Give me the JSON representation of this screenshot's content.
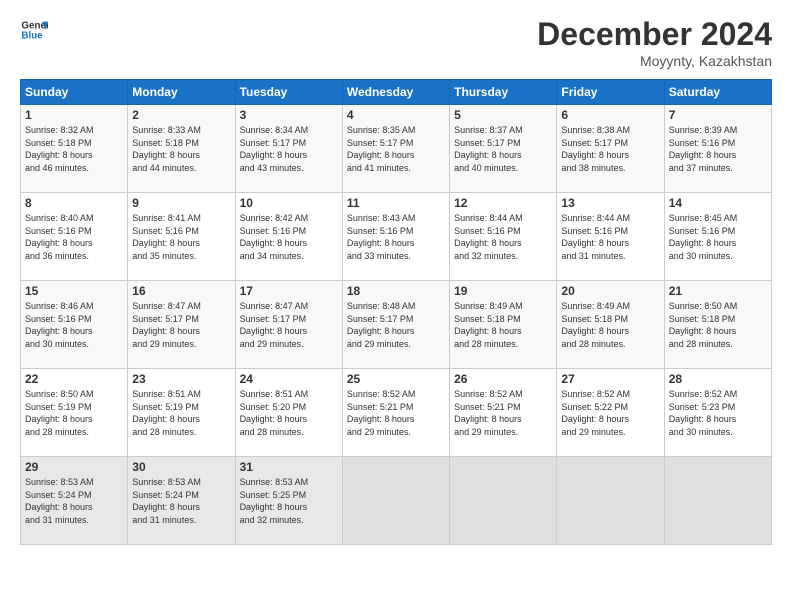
{
  "header": {
    "logo_line1": "General",
    "logo_line2": "Blue",
    "title": "December 2024",
    "subtitle": "Moyynty, Kazakhstan"
  },
  "days_of_week": [
    "Sunday",
    "Monday",
    "Tuesday",
    "Wednesday",
    "Thursday",
    "Friday",
    "Saturday"
  ],
  "weeks": [
    [
      {
        "num": "1",
        "info": "Sunrise: 8:32 AM\nSunset: 5:18 PM\nDaylight: 8 hours\nand 46 minutes."
      },
      {
        "num": "2",
        "info": "Sunrise: 8:33 AM\nSunset: 5:18 PM\nDaylight: 8 hours\nand 44 minutes."
      },
      {
        "num": "3",
        "info": "Sunrise: 8:34 AM\nSunset: 5:17 PM\nDaylight: 8 hours\nand 43 minutes."
      },
      {
        "num": "4",
        "info": "Sunrise: 8:35 AM\nSunset: 5:17 PM\nDaylight: 8 hours\nand 41 minutes."
      },
      {
        "num": "5",
        "info": "Sunrise: 8:37 AM\nSunset: 5:17 PM\nDaylight: 8 hours\nand 40 minutes."
      },
      {
        "num": "6",
        "info": "Sunrise: 8:38 AM\nSunset: 5:17 PM\nDaylight: 8 hours\nand 38 minutes."
      },
      {
        "num": "7",
        "info": "Sunrise: 8:39 AM\nSunset: 5:16 PM\nDaylight: 8 hours\nand 37 minutes."
      }
    ],
    [
      {
        "num": "8",
        "info": "Sunrise: 8:40 AM\nSunset: 5:16 PM\nDaylight: 8 hours\nand 36 minutes."
      },
      {
        "num": "9",
        "info": "Sunrise: 8:41 AM\nSunset: 5:16 PM\nDaylight: 8 hours\nand 35 minutes."
      },
      {
        "num": "10",
        "info": "Sunrise: 8:42 AM\nSunset: 5:16 PM\nDaylight: 8 hours\nand 34 minutes."
      },
      {
        "num": "11",
        "info": "Sunrise: 8:43 AM\nSunset: 5:16 PM\nDaylight: 8 hours\nand 33 minutes."
      },
      {
        "num": "12",
        "info": "Sunrise: 8:44 AM\nSunset: 5:16 PM\nDaylight: 8 hours\nand 32 minutes."
      },
      {
        "num": "13",
        "info": "Sunrise: 8:44 AM\nSunset: 5:16 PM\nDaylight: 8 hours\nand 31 minutes."
      },
      {
        "num": "14",
        "info": "Sunrise: 8:45 AM\nSunset: 5:16 PM\nDaylight: 8 hours\nand 30 minutes."
      }
    ],
    [
      {
        "num": "15",
        "info": "Sunrise: 8:46 AM\nSunset: 5:16 PM\nDaylight: 8 hours\nand 30 minutes."
      },
      {
        "num": "16",
        "info": "Sunrise: 8:47 AM\nSunset: 5:17 PM\nDaylight: 8 hours\nand 29 minutes."
      },
      {
        "num": "17",
        "info": "Sunrise: 8:47 AM\nSunset: 5:17 PM\nDaylight: 8 hours\nand 29 minutes."
      },
      {
        "num": "18",
        "info": "Sunrise: 8:48 AM\nSunset: 5:17 PM\nDaylight: 8 hours\nand 29 minutes."
      },
      {
        "num": "19",
        "info": "Sunrise: 8:49 AM\nSunset: 5:18 PM\nDaylight: 8 hours\nand 28 minutes."
      },
      {
        "num": "20",
        "info": "Sunrise: 8:49 AM\nSunset: 5:18 PM\nDaylight: 8 hours\nand 28 minutes."
      },
      {
        "num": "21",
        "info": "Sunrise: 8:50 AM\nSunset: 5:18 PM\nDaylight: 8 hours\nand 28 minutes."
      }
    ],
    [
      {
        "num": "22",
        "info": "Sunrise: 8:50 AM\nSunset: 5:19 PM\nDaylight: 8 hours\nand 28 minutes."
      },
      {
        "num": "23",
        "info": "Sunrise: 8:51 AM\nSunset: 5:19 PM\nDaylight: 8 hours\nand 28 minutes."
      },
      {
        "num": "24",
        "info": "Sunrise: 8:51 AM\nSunset: 5:20 PM\nDaylight: 8 hours\nand 28 minutes."
      },
      {
        "num": "25",
        "info": "Sunrise: 8:52 AM\nSunset: 5:21 PM\nDaylight: 8 hours\nand 29 minutes."
      },
      {
        "num": "26",
        "info": "Sunrise: 8:52 AM\nSunset: 5:21 PM\nDaylight: 8 hours\nand 29 minutes."
      },
      {
        "num": "27",
        "info": "Sunrise: 8:52 AM\nSunset: 5:22 PM\nDaylight: 8 hours\nand 29 minutes."
      },
      {
        "num": "28",
        "info": "Sunrise: 8:52 AM\nSunset: 5:23 PM\nDaylight: 8 hours\nand 30 minutes."
      }
    ],
    [
      {
        "num": "29",
        "info": "Sunrise: 8:53 AM\nSunset: 5:24 PM\nDaylight: 8 hours\nand 31 minutes."
      },
      {
        "num": "30",
        "info": "Sunrise: 8:53 AM\nSunset: 5:24 PM\nDaylight: 8 hours\nand 31 minutes."
      },
      {
        "num": "31",
        "info": "Sunrise: 8:53 AM\nSunset: 5:25 PM\nDaylight: 8 hours\nand 32 minutes."
      },
      {
        "num": "",
        "info": ""
      },
      {
        "num": "",
        "info": ""
      },
      {
        "num": "",
        "info": ""
      },
      {
        "num": "",
        "info": ""
      }
    ]
  ]
}
